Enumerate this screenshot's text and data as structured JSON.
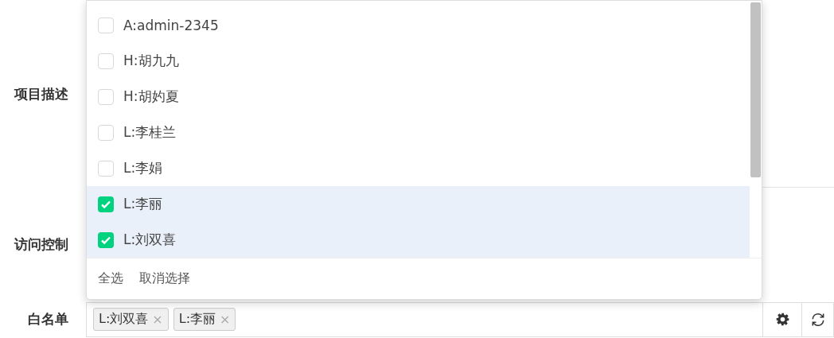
{
  "form": {
    "rows": [
      {
        "label": "项目描述",
        "kind": "textarea"
      },
      {
        "label": "访问控制",
        "kind": "blank"
      },
      {
        "label": "白名单",
        "kind": "tags"
      }
    ]
  },
  "whitelist": {
    "tags": [
      {
        "label": "L:刘双喜",
        "remove": "×"
      },
      {
        "label": "L:李丽",
        "remove": "×"
      }
    ]
  },
  "dropdown": {
    "options": [
      {
        "label": "A:admin-2345",
        "checked": false
      },
      {
        "label": "H:胡九九",
        "checked": false
      },
      {
        "label": "H:胡妁夏",
        "checked": false
      },
      {
        "label": "L:李桂兰",
        "checked": false
      },
      {
        "label": "L:李娟",
        "checked": false
      },
      {
        "label": "L:李丽",
        "checked": true
      },
      {
        "label": "L:刘双喜",
        "checked": true
      }
    ],
    "actions": [
      "全选",
      "取消选择"
    ]
  }
}
